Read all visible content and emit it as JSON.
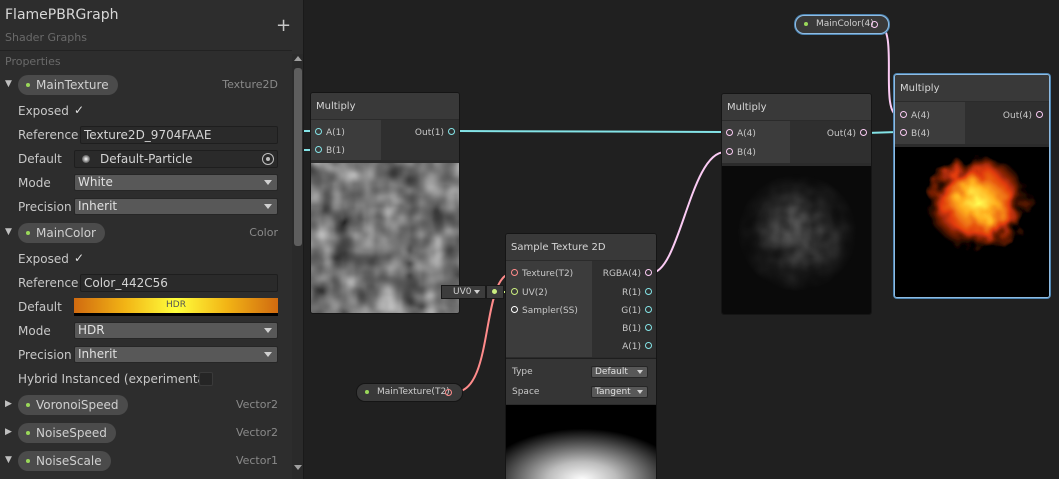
{
  "colors": {
    "port_float": "#84e4e7",
    "port_vector4": "#fbcbf4",
    "port_texture": "#ff8b8b",
    "port_uv": "#cbee80",
    "port_sampler": "#ffffff",
    "selection": "#8fbce3"
  },
  "blackboard": {
    "title": "FlamePBRGraph",
    "subtitle": "Shader Graphs",
    "add_icon": "+",
    "section_label": "Properties",
    "properties": [
      {
        "name": "MainTexture",
        "type": "Texture2D",
        "expanded": true,
        "fields": {
          "exposed_label": "Exposed",
          "reference_label": "Reference",
          "reference_value": "Texture2D_9704FAAE",
          "default_label": "Default",
          "default_value": "Default-Particle",
          "mode_label": "Mode",
          "mode_value": "White",
          "precision_label": "Precision",
          "precision_value": "Inherit"
        }
      },
      {
        "name": "MainColor",
        "type": "Color",
        "expanded": true,
        "fields": {
          "exposed_label": "Exposed",
          "reference_label": "Reference",
          "reference_value": "Color_442C56",
          "default_label": "Default",
          "default_value": "HDR",
          "mode_label": "Mode",
          "mode_value": "HDR",
          "precision_label": "Precision",
          "precision_value": "Inherit",
          "hybrid_label": "Hybrid Instanced (experimental)"
        }
      },
      {
        "name": "VoronoiSpeed",
        "type": "Vector2",
        "expanded": false
      },
      {
        "name": "NoiseSpeed",
        "type": "Vector2",
        "expanded": false
      },
      {
        "name": "NoiseScale",
        "type": "Vector1",
        "expanded": true
      }
    ]
  },
  "graph": {
    "multiply_1": {
      "title": "Multiply",
      "inputs": [
        "A(1)",
        "B(1)"
      ],
      "output": "Out(1)"
    },
    "multiply_2": {
      "title": "Multiply",
      "inputs": [
        "A(4)",
        "B(4)"
      ],
      "output": "Out(4)"
    },
    "multiply_3": {
      "title": "Multiply",
      "inputs": [
        "A(4)",
        "B(4)"
      ],
      "output": "Out(4)"
    },
    "sample_texture": {
      "title": "Sample Texture 2D",
      "inputs": [
        "Texture(T2)",
        "UV(2)",
        "Sampler(SS)"
      ],
      "outputs": [
        "RGBA(4)",
        "R(1)",
        "G(1)",
        "B(1)",
        "A(1)"
      ],
      "uv_value": "UV0",
      "type_label": "Type",
      "type_value": "Default",
      "space_label": "Space",
      "space_value": "Tangent"
    },
    "main_color_chip": "MainColor(4)",
    "main_texture_chip": "MainTexture(T2)"
  }
}
